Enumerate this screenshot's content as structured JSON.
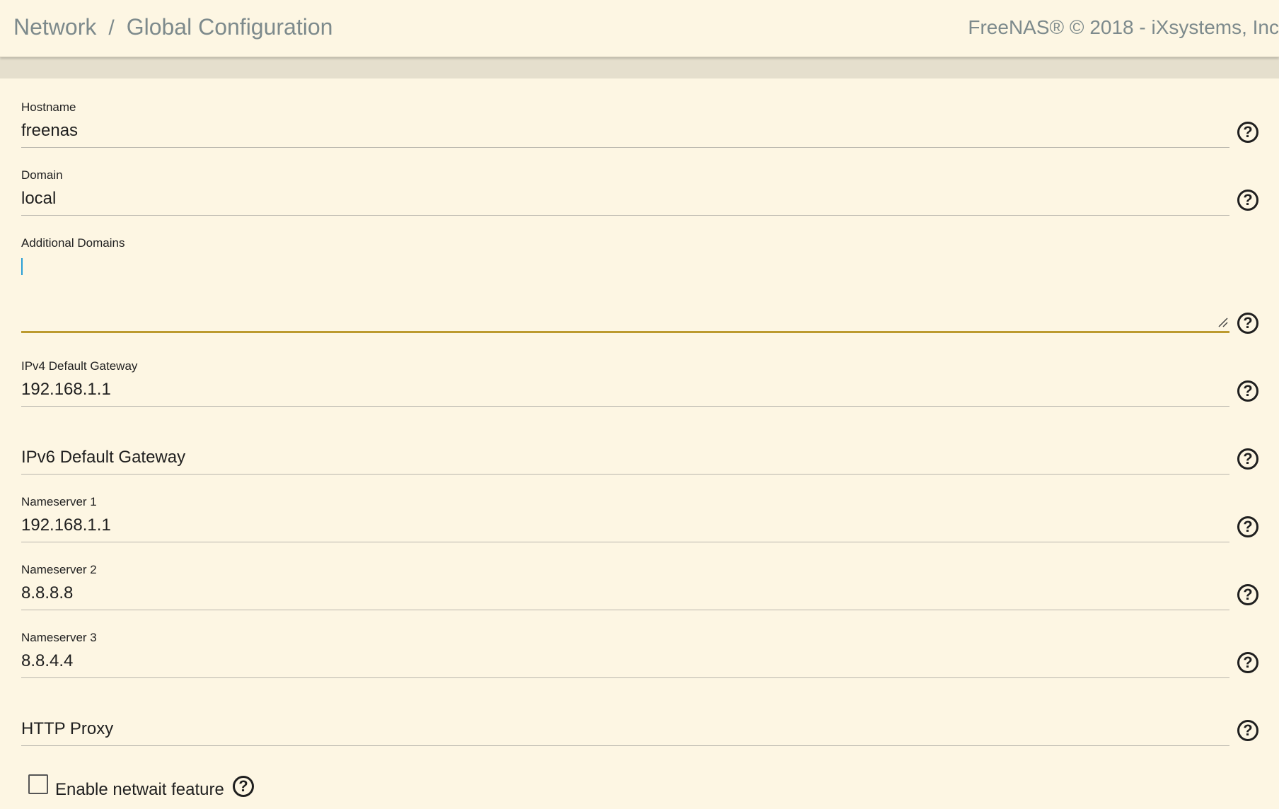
{
  "header": {
    "breadcrumb": [
      "Network",
      "Global Configuration"
    ],
    "separator": "/",
    "copyright": "FreeNAS® © 2018 - iXsystems, Inc"
  },
  "form": {
    "hostname": {
      "label": "Hostname",
      "value": "freenas"
    },
    "domain": {
      "label": "Domain",
      "value": "local"
    },
    "additional_domains": {
      "label": "Additional Domains",
      "value": ""
    },
    "ipv4_gateway": {
      "label": "IPv4 Default Gateway",
      "value": "192.168.1.1"
    },
    "ipv6_gateway": {
      "placeholder": "IPv6 Default Gateway",
      "value": ""
    },
    "nameserver1": {
      "label": "Nameserver 1",
      "value": "192.168.1.1"
    },
    "nameserver2": {
      "label": "Nameserver 2",
      "value": "8.8.8.8"
    },
    "nameserver3": {
      "label": "Nameserver 3",
      "value": "8.8.4.4"
    },
    "http_proxy": {
      "placeholder": "HTTP Proxy",
      "value": ""
    },
    "netwait": {
      "label": "Enable netwait feature",
      "checked": false
    }
  },
  "help_glyph": "?",
  "icons": {
    "help": "help-circle-icon",
    "resize": "resize-handle-icon"
  },
  "colors": {
    "background": "#fdf6e3",
    "active_underline": "#bc9a2f",
    "header_text": "#7d8a8c"
  }
}
